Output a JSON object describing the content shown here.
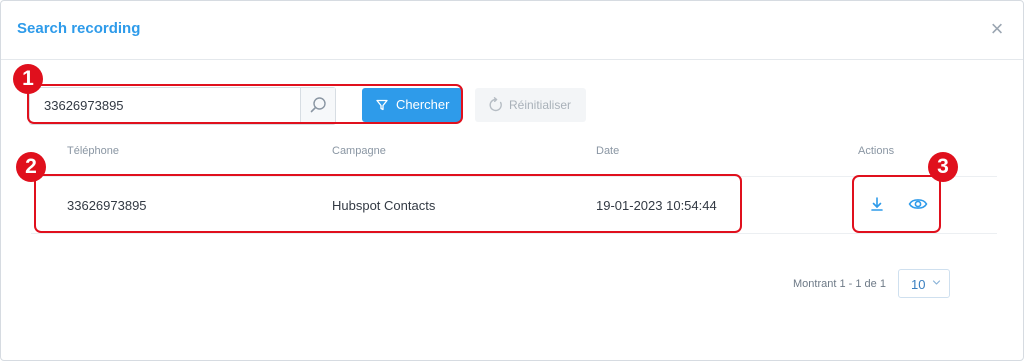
{
  "modal": {
    "title": "Search recording",
    "close_glyph": "×"
  },
  "search": {
    "value": "33626973895",
    "placeholder": "",
    "search_icon": "search-icon"
  },
  "buttons": {
    "search_label": "Chercher",
    "search_icon": "filter-icon",
    "reset_label": "Réinitialiser",
    "reset_icon": "refresh-icon"
  },
  "table": {
    "columns": [
      "Téléphone",
      "Campagne",
      "Date",
      "Actions"
    ],
    "rows": [
      {
        "telephone": "33626973895",
        "campagne": "Hubspot Contacts",
        "date": "19-01-2023 10:54:44",
        "actions": [
          "download-icon",
          "eye-icon"
        ]
      }
    ]
  },
  "pagination": {
    "summary": "Montrant 1 - 1 de 1",
    "page_size": "10",
    "page_size_icon": "chevron-down-icon"
  },
  "annotations": {
    "markers": [
      "1",
      "2",
      "3"
    ],
    "color": "#e0101d"
  },
  "colors": {
    "accent": "#2e9bea",
    "text": "#333a44",
    "muted": "#8a96a3"
  }
}
